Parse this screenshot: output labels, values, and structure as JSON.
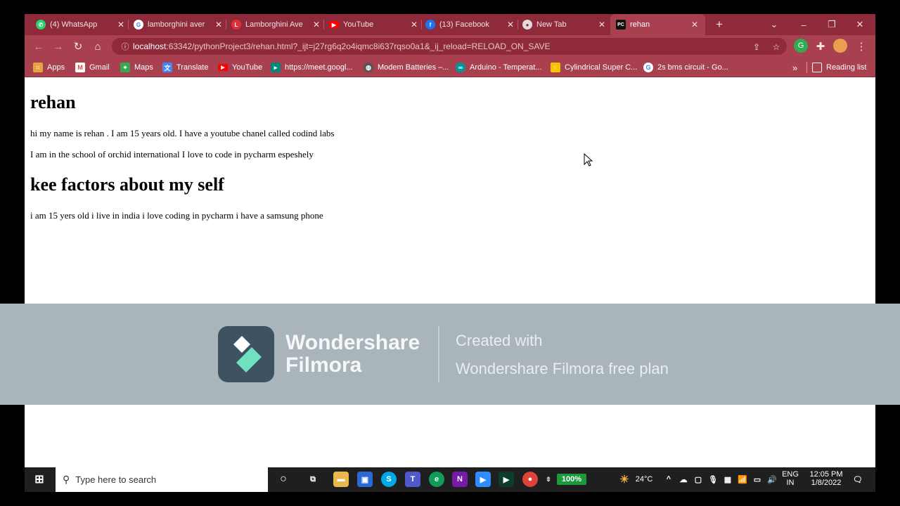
{
  "browser": {
    "tabs": [
      {
        "label": "(4) WhatsApp",
        "icon": "whatsapp-icon",
        "color": "#25d366"
      },
      {
        "label": "lamborghini aver",
        "icon": "google-icon",
        "color": "#4285f4"
      },
      {
        "label": "Lamborghini Ave",
        "icon": "lamborghini-site-icon",
        "color": "#e0303a"
      },
      {
        "label": "YouTube",
        "icon": "youtube-icon",
        "color": "#ff0000"
      },
      {
        "label": "(13) Facebook",
        "icon": "facebook-icon",
        "color": "#1877f2"
      },
      {
        "label": "New Tab",
        "icon": "chrome-icon",
        "color": "#dddddd"
      },
      {
        "label": "rehan",
        "icon": "pycharm-icon",
        "color": "#111111"
      }
    ],
    "new_tab_symbol": "+",
    "close_symbol": "✕",
    "url_host": "localhost",
    "url_rest": ":63342/pythonProject3/rehan.html?_ijt=j27rg6q2o4iqmc8i637rqso0a1&_ij_reload=RELOAD_ON_SAVE",
    "bookmarks": [
      {
        "label": "Apps",
        "icon": "apps-grid-icon",
        "color": "#e8a33d"
      },
      {
        "label": "Gmail",
        "icon": "gmail-icon",
        "color": "#ea4335"
      },
      {
        "label": "Maps",
        "icon": "maps-icon",
        "color": "#34a853"
      },
      {
        "label": "Translate",
        "icon": "translate-icon",
        "color": "#4285f4"
      },
      {
        "label": "YouTube",
        "icon": "youtube-icon",
        "color": "#ff0000"
      },
      {
        "label": "https://meet.googl...",
        "icon": "meet-icon",
        "color": "#00897b"
      },
      {
        "label": "Modem Batteries –...",
        "icon": "globe-icon",
        "color": "#555555"
      },
      {
        "label": "Arduino - Temperat...",
        "icon": "arduino-icon",
        "color": "#00979c"
      },
      {
        "label": "Cylindrical Super C...",
        "icon": "bolt-icon",
        "color": "#f5c400"
      },
      {
        "label": "2s bms circuit - Go...",
        "icon": "google-icon",
        "color": "#4285f4"
      }
    ],
    "reading_list": "Reading list",
    "more_bookmarks": "»"
  },
  "page": {
    "title": "rehan",
    "para1": "hi my name is rehan . I am 15 years old. I have a youtube chanel called codind labs",
    "para2": "I am in the school of orchid international I love to code in pycharm espeshely",
    "heading2": "kee factors about my self",
    "para3": "i am 15 yers old i live in india i love coding in pycharm i have a samsung phone"
  },
  "watermark": {
    "brand_line1": "Wondershare",
    "brand_line2": "Filmora",
    "created_with": "Created with",
    "plan": "Wondershare Filmora free plan"
  },
  "taskbar": {
    "search_placeholder": "Type here to search",
    "battery_percent": "100%",
    "temperature": "24°C",
    "language_1": "ENG",
    "language_2": "IN",
    "time": "12:05 PM",
    "date": "1/8/2022"
  }
}
